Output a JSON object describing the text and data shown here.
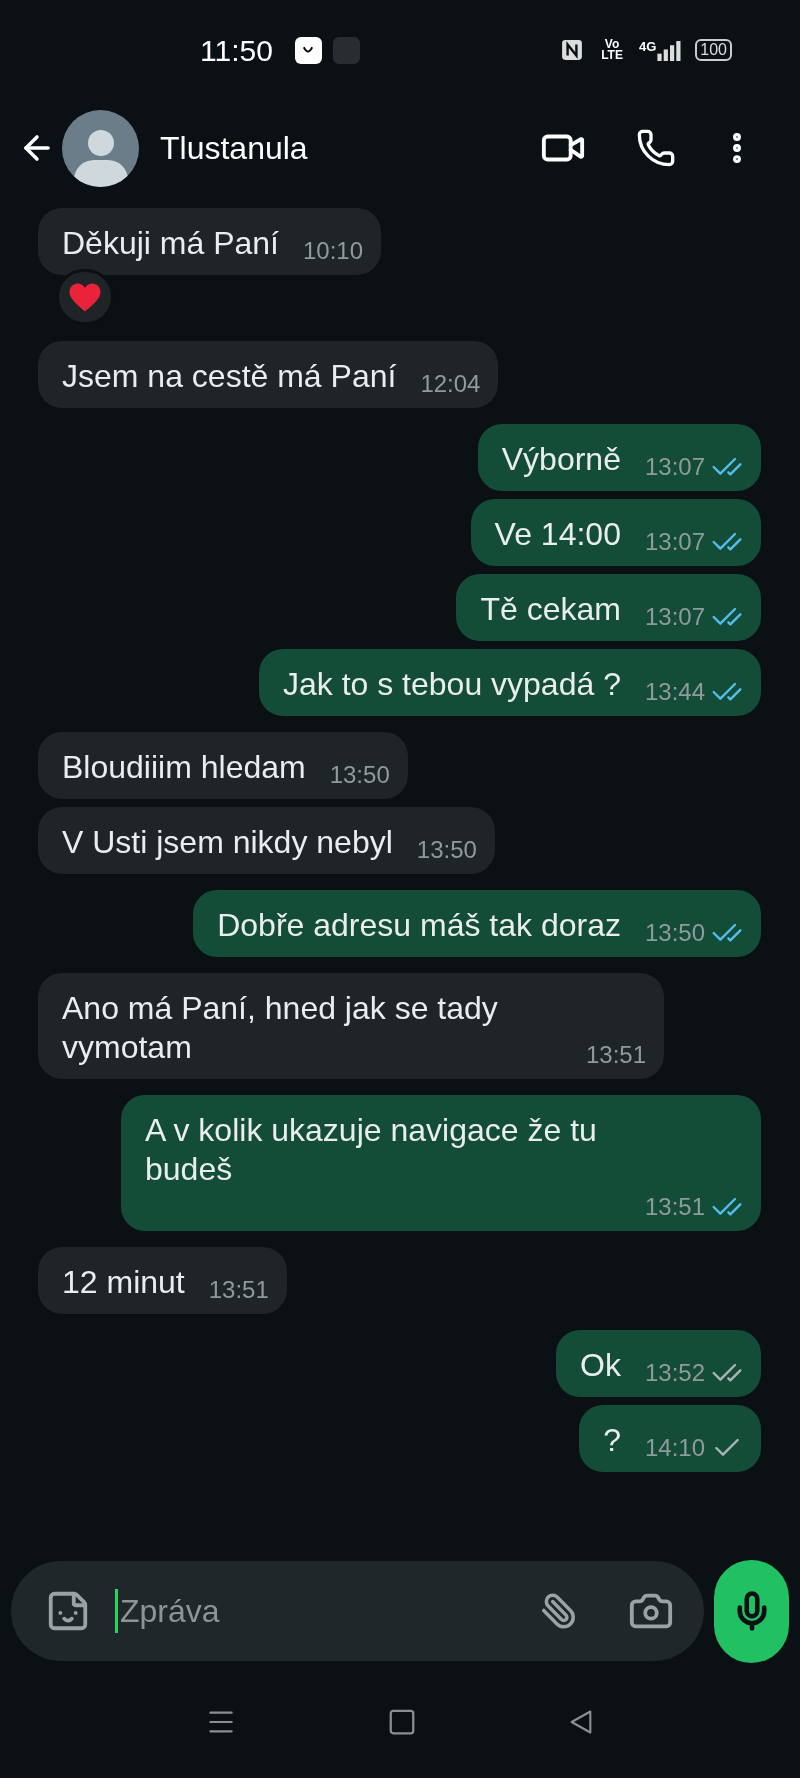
{
  "status_bar": {
    "time": "11:50",
    "volte": [
      "Vo",
      "LTE"
    ],
    "network": "4G",
    "battery": "100"
  },
  "header": {
    "contact": "Tlustanula"
  },
  "messages": [
    {
      "outgoing": false,
      "text": "Děkuji má Paní",
      "time": "10:10",
      "reacted": true
    },
    {
      "outgoing": false,
      "text": "Jsem na cestě má Paní",
      "time": "12:04",
      "reacted": false
    },
    {
      "outgoing": true,
      "text": "Výborně",
      "time": "13:07",
      "delivered": true,
      "read": true,
      "reacted": false
    },
    {
      "outgoing": true,
      "text": "Ve 14:00",
      "time": "13:07",
      "delivered": true,
      "read": true,
      "reacted": false
    },
    {
      "outgoing": true,
      "text": "Tě cekam",
      "time": "13:07",
      "delivered": true,
      "read": true,
      "reacted": false
    },
    {
      "outgoing": true,
      "text": "Jak to s tebou vypadá ?",
      "time": "13:44",
      "delivered": true,
      "read": true,
      "reacted": false
    },
    {
      "outgoing": false,
      "text": "Bloudiiim hledam",
      "time": "13:50",
      "reacted": false
    },
    {
      "outgoing": false,
      "text": "V Usti jsem nikdy nebyl",
      "time": "13:50",
      "reacted": false
    },
    {
      "outgoing": true,
      "text": "Dobře adresu máš tak doraz",
      "time": "13:50",
      "delivered": true,
      "read": true,
      "reacted": false
    },
    {
      "outgoing": false,
      "text": "Ano má Paní, hned jak se tady vymotam",
      "time": "13:51",
      "reacted": false
    },
    {
      "outgoing": true,
      "text": "A v kolik ukazuje navigace že tu budeš",
      "time": "13:51",
      "delivered": true,
      "read": true,
      "reacted": false
    },
    {
      "outgoing": false,
      "text": "12 minut",
      "time": "13:51",
      "reacted": false
    },
    {
      "outgoing": true,
      "text": "Ok",
      "time": "13:52",
      "delivered": true,
      "read": false,
      "reacted": false
    },
    {
      "outgoing": true,
      "text": "?",
      "time": "14:10",
      "delivered": false,
      "read": false,
      "reacted": false
    }
  ],
  "composer": {
    "placeholder": "Zpráva"
  }
}
